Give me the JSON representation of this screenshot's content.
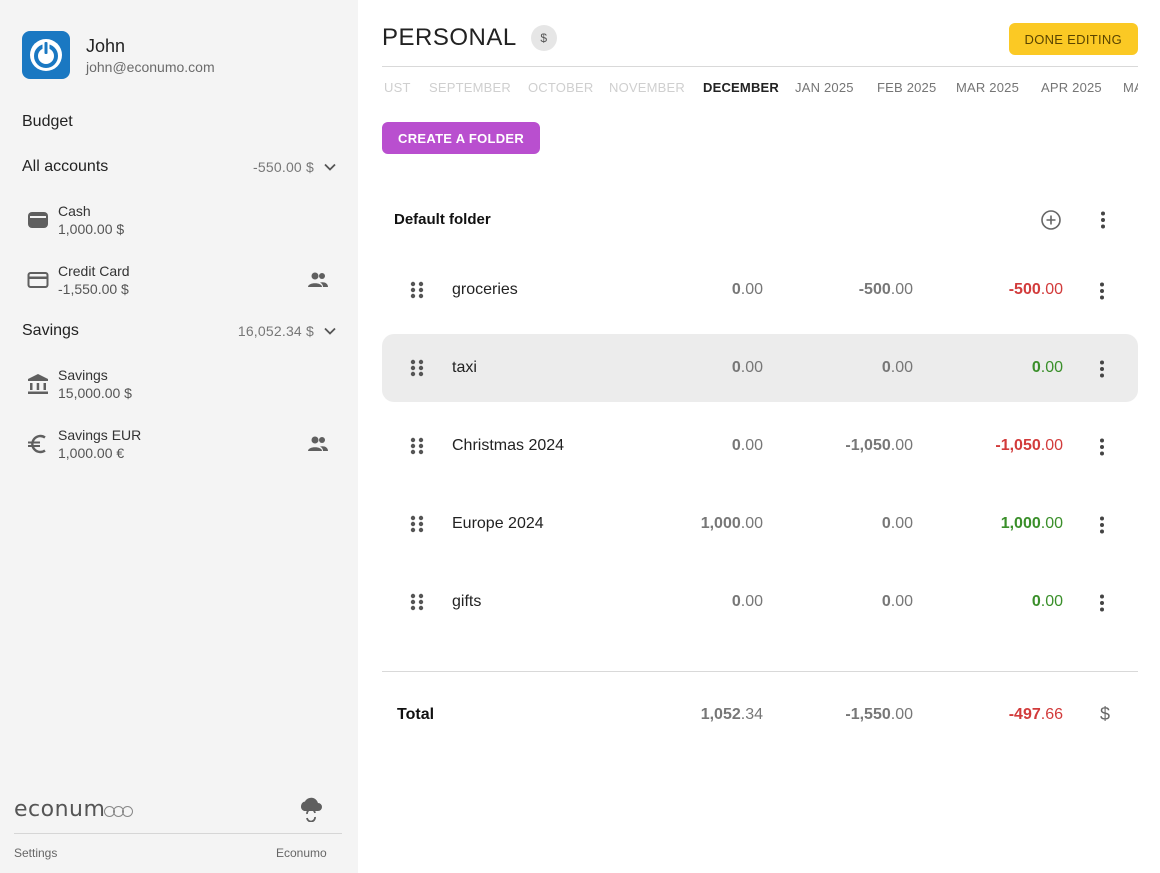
{
  "profile": {
    "name": "John",
    "email": "john@econumo.com"
  },
  "sidebar": {
    "budget_label": "Budget",
    "groups": [
      {
        "title": "All accounts",
        "total": "-550.00 $",
        "accounts": [
          {
            "name": "Cash",
            "balance": "1,000.00 $",
            "icon": "wallet-icon",
            "shared": false
          },
          {
            "name": "Credit Card",
            "balance": "-1,550.00 $",
            "icon": "credit-card-icon",
            "shared": true
          }
        ]
      },
      {
        "title": "Savings",
        "total": "16,052.34 $",
        "accounts": [
          {
            "name": "Savings",
            "balance": "15,000.00 $",
            "icon": "bank-icon",
            "shared": false
          },
          {
            "name": "Savings EUR",
            "balance": "1,000.00 €",
            "icon": "euro-icon",
            "shared": true
          }
        ]
      }
    ],
    "logo_text": "econum",
    "footer": {
      "settings": "Settings",
      "brand": "Econumo"
    }
  },
  "header": {
    "title": "PERSONAL",
    "currency_chip": "$",
    "done_label": "DONE EDITING"
  },
  "months": {
    "items": [
      "UST",
      "SEPTEMBER",
      "OCTOBER",
      "NOVEMBER",
      "DECEMBER",
      "JAN 2025",
      "FEB 2025",
      "MAR 2025",
      "APR 2025",
      "MA"
    ],
    "active": "DECEMBER"
  },
  "create_folder_label": "CREATE A FOLDER",
  "folder": {
    "title": "Default folder",
    "rows": [
      {
        "name": "groceries",
        "c1": [
          "0",
          ".00"
        ],
        "c2": [
          "-500",
          ".00"
        ],
        "c3": [
          "-500",
          ".00"
        ],
        "c3_sign": "neg"
      },
      {
        "name": "taxi",
        "c1": [
          "0",
          ".00"
        ],
        "c2": [
          "0",
          ".00"
        ],
        "c3": [
          "0",
          ".00"
        ],
        "c3_sign": "pos"
      },
      {
        "name": "Christmas 2024",
        "c1": [
          "0",
          ".00"
        ],
        "c2": [
          "-1,050",
          ".00"
        ],
        "c3": [
          "-1,050",
          ".00"
        ],
        "c3_sign": "neg"
      },
      {
        "name": "Europe 2024",
        "c1": [
          "1,000",
          ".00"
        ],
        "c2": [
          "0",
          ".00"
        ],
        "c3": [
          "1,000",
          ".00"
        ],
        "c3_sign": "pos"
      },
      {
        "name": "gifts",
        "c1": [
          "0",
          ".00"
        ],
        "c2": [
          "0",
          ".00"
        ],
        "c3": [
          "0",
          ".00"
        ],
        "c3_sign": "pos"
      }
    ]
  },
  "total": {
    "label": "Total",
    "c1": [
      "1,052",
      ".34"
    ],
    "c2": [
      "-1,550",
      ".00"
    ],
    "c3": [
      "-497",
      ".66"
    ],
    "currency": "$"
  },
  "colors": {
    "accent_purple": "#b94fcf",
    "accent_yellow": "#fbc924",
    "negative": "#d23b3b",
    "positive": "#3a8f2a",
    "logo_blue": "#1a78c2"
  }
}
